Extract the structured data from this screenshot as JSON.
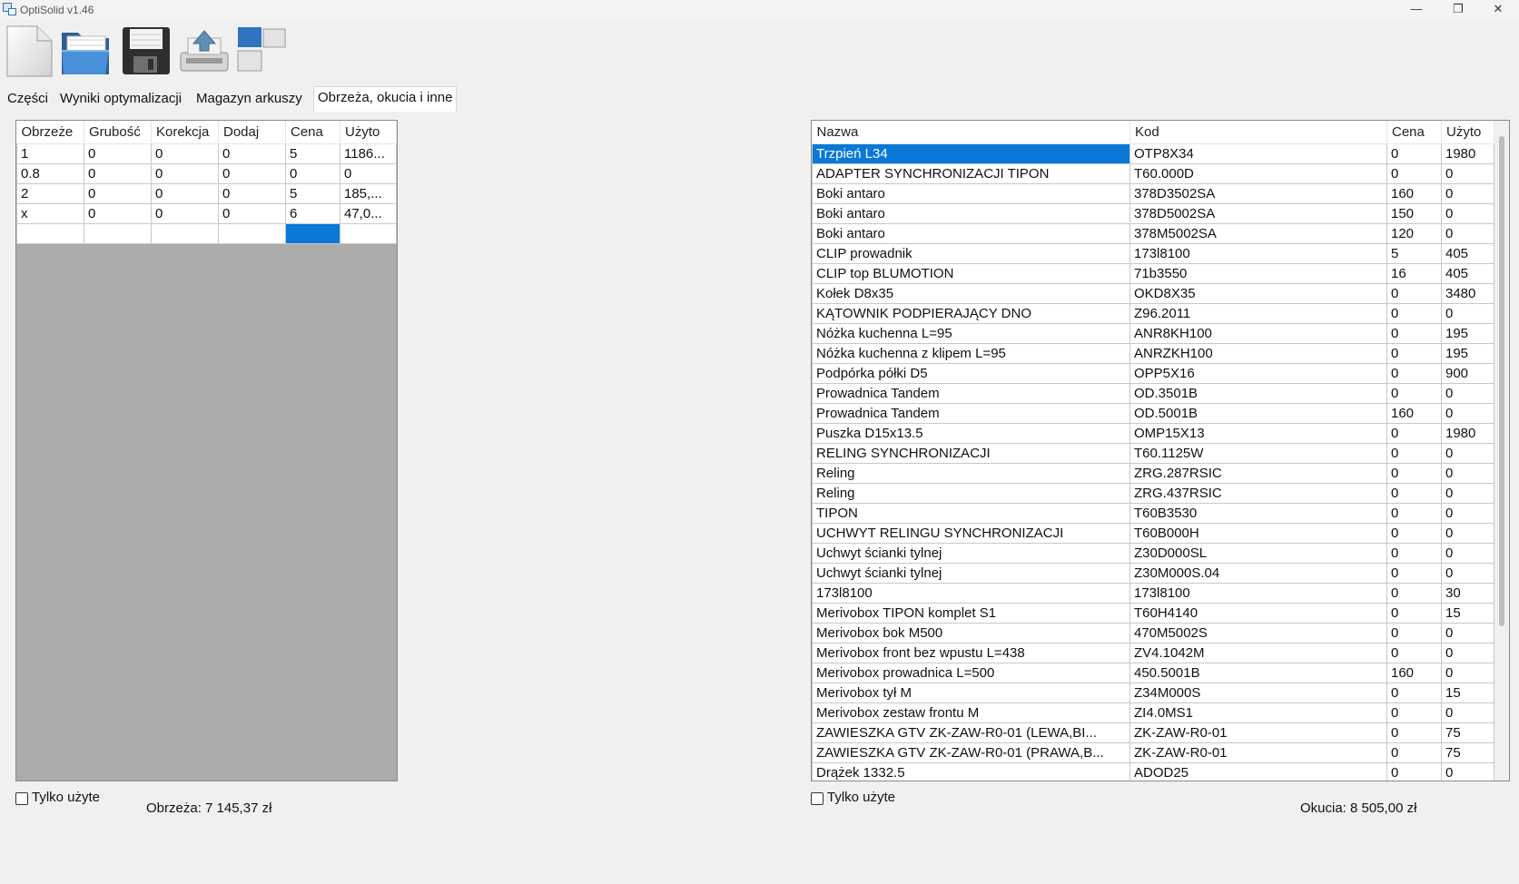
{
  "window": {
    "title": "OptiSolid v1.46"
  },
  "toolbar": [
    {
      "name": "new-file-button"
    },
    {
      "name": "open-folder-button"
    },
    {
      "name": "save-button"
    },
    {
      "name": "export-button"
    },
    {
      "name": "windows-layout-button"
    }
  ],
  "tabs": [
    "Części",
    "Wyniki optymalizacji",
    "Magazyn arkuszy",
    "Obrzeża, okucia i inne"
  ],
  "active_tab": 3,
  "left": {
    "columns": [
      "Obrzeże",
      "Grubość",
      "Korekcja",
      "Dodaj",
      "Cena",
      "Użyto"
    ],
    "rows": [
      [
        "1",
        "0",
        "0",
        "0",
        "5",
        "1186..."
      ],
      [
        "0.8",
        "0",
        "0",
        "0",
        "0",
        "0"
      ],
      [
        "2",
        "0",
        "0",
        "0",
        "5",
        "185,..."
      ],
      [
        "x",
        "0",
        "0",
        "0",
        "6",
        "47,0..."
      ],
      [
        "",
        "",
        "",
        "",
        "",
        ""
      ]
    ],
    "checkbox_label": "Tylko użyte",
    "total": "Obrzeża: 7 145,37 zł"
  },
  "right": {
    "columns": [
      "Nazwa",
      "Kod",
      "Cena",
      "Użyto"
    ],
    "rows": [
      [
        "Trzpień L34",
        "OTP8X34",
        "0",
        "1980"
      ],
      [
        "ADAPTER SYNCHRONIZACJI TIPON",
        "T60.000D",
        "0",
        "0"
      ],
      [
        "Boki antaro",
        "378D3502SA",
        "160",
        "0"
      ],
      [
        "Boki antaro",
        "378D5002SA",
        "150",
        "0"
      ],
      [
        "Boki antaro",
        "378M5002SA",
        "120",
        "0"
      ],
      [
        "CLIP prowadnik",
        "173l8100",
        "5",
        "405"
      ],
      [
        "CLIP top BLUMOTION",
        "71b3550",
        "16",
        "405"
      ],
      [
        "Kołek D8x35",
        "OKD8X35",
        "0",
        "3480"
      ],
      [
        "KĄTOWNIK PODPIERAJĄCY DNO",
        "Z96.2011",
        "0",
        "0"
      ],
      [
        "Nóżka kuchenna L=95",
        "ANR8KH100",
        "0",
        "195"
      ],
      [
        "Nóżka kuchenna z klipem L=95",
        "ANRZKH100",
        "0",
        "195"
      ],
      [
        "Podpórka półki D5",
        "OPP5X16",
        "0",
        "900"
      ],
      [
        "Prowadnica Tandem",
        "OD.3501B",
        "0",
        "0"
      ],
      [
        "Prowadnica Tandem",
        "OD.5001B",
        "160",
        "0"
      ],
      [
        "Puszka D15x13.5",
        "OMP15X13",
        "0",
        "1980"
      ],
      [
        "RELING SYNCHRONIZACJI",
        "T60.1125W",
        "0",
        "0"
      ],
      [
        "Reling",
        "ZRG.287RSIC",
        "0",
        "0"
      ],
      [
        "Reling",
        "ZRG.437RSIC",
        "0",
        "0"
      ],
      [
        "TIPON",
        "T60B3530",
        "0",
        "0"
      ],
      [
        "UCHWYT RELINGU SYNCHRONIZACJI",
        "T60B000H",
        "0",
        "0"
      ],
      [
        "Uchwyt ścianki tylnej",
        "Z30D000SL",
        "0",
        "0"
      ],
      [
        "Uchwyt ścianki tylnej",
        "Z30M000S.04",
        "0",
        "0"
      ],
      [
        "173l8100",
        "173l8100",
        "0",
        "30"
      ],
      [
        "Merivobox TIPON komplet S1",
        "T60H4140",
        "0",
        "15"
      ],
      [
        "Merivobox bok M500",
        "470M5002S",
        "0",
        "0"
      ],
      [
        "Merivobox front bez wpustu L=438",
        "ZV4.1042M",
        "0",
        "0"
      ],
      [
        "Merivobox prowadnica L=500",
        "450.5001B",
        "160",
        "0"
      ],
      [
        "Merivobox tył M",
        "Z34M000S",
        "0",
        "15"
      ],
      [
        "Merivobox zestaw frontu M",
        "ZI4.0MS1",
        "0",
        "0"
      ],
      [
        "ZAWIESZKA GTV ZK-ZAW-R0-01 (LEWA,BI...",
        "ZK-ZAW-R0-01",
        "0",
        "75"
      ],
      [
        "ZAWIESZKA GTV ZK-ZAW-R0-01 (PRAWA,B...",
        "ZK-ZAW-R0-01",
        "0",
        "75"
      ],
      [
        "Drążek 1332.5",
        "ADOD25",
        "0",
        "0"
      ]
    ],
    "checkbox_label": "Tylko użyte",
    "total": "Okucia: 8 505,00 zł"
  },
  "colors": {
    "selection": "#0a78d7",
    "grid_background": "#ababab"
  }
}
